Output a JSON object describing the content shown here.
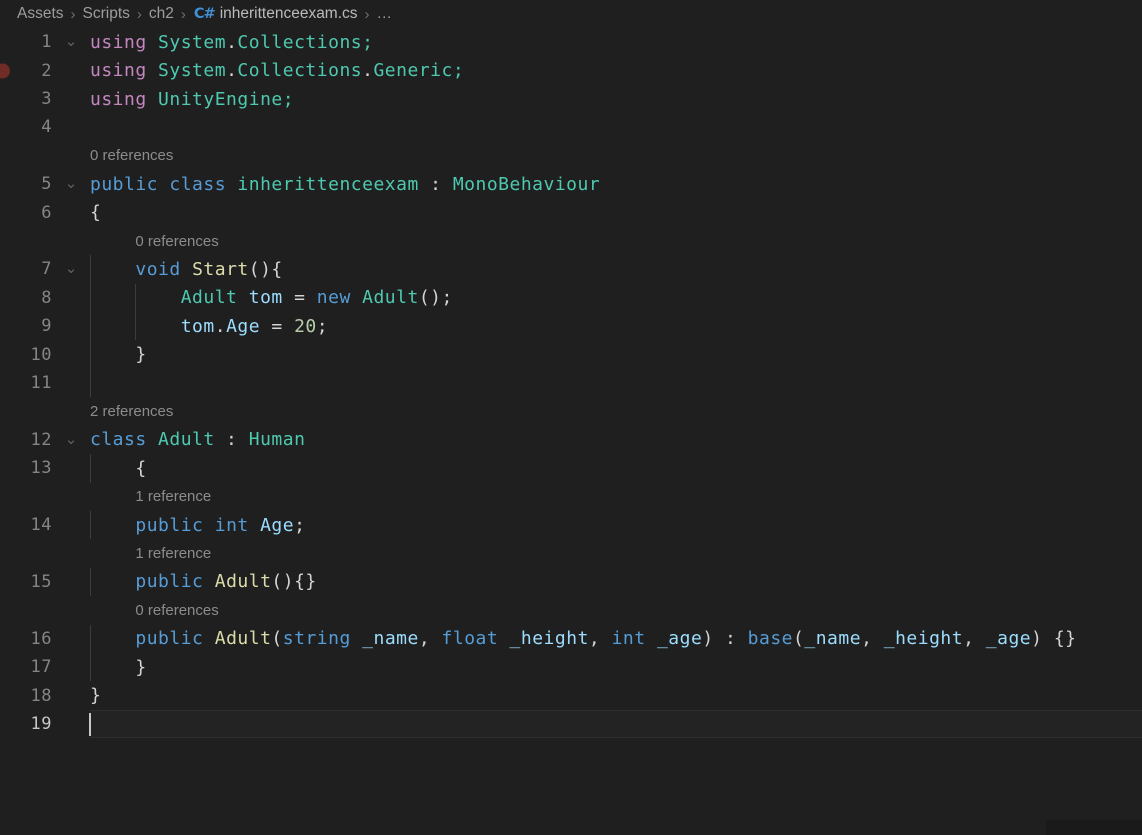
{
  "breadcrumb": {
    "separator": "›",
    "items": [
      {
        "label": "Assets"
      },
      {
        "label": "Scripts"
      },
      {
        "label": "ch2"
      },
      {
        "label": "inherittenceexam.cs",
        "icon": "csharp-file-icon",
        "icon_label": "C#",
        "is_file": true
      },
      {
        "label": "…"
      }
    ]
  },
  "editor": {
    "colors": {
      "bg": "#1f1f1f",
      "breadcrumbText": "#9d9d9d",
      "breadcrumbFile": "#bbbbbb",
      "separator": "#6f6f6f",
      "csharpIcon": "#3f8fd2",
      "lineNumber": "#858585",
      "lineNumberActive": "#c6c6c6",
      "foldIcon": "#5f6264",
      "breakpoint": "#702c26",
      "guide": "#3d3d3d",
      "currentLineBg": "#232323",
      "currentLineBorder": "#2e2e2e",
      "cursor": "#c8c8c8",
      "codelens": "#8c8c8c",
      "kw": "#569cd6",
      "ctl": "#c586c0",
      "type": "#4ec9b0",
      "fn": "#dcdcaa",
      "var": "#9cdcfe",
      "numlit": "#b5cea8",
      "plain": "#d4d4d4"
    },
    "rows": [
      {
        "type": "code",
        "num": "1",
        "fold": true,
        "tokens": [
          [
            "ctl",
            "using"
          ],
          [
            "plain",
            " "
          ],
          [
            "type",
            "System"
          ],
          [
            "plain",
            "."
          ],
          [
            "type",
            "Collections"
          ],
          [
            "type",
            ";"
          ]
        ]
      },
      {
        "type": "code",
        "num": "2",
        "bp": true,
        "tokens": [
          [
            "ctl",
            "using"
          ],
          [
            "plain",
            " "
          ],
          [
            "type",
            "System"
          ],
          [
            "plain",
            "."
          ],
          [
            "type",
            "Collections"
          ],
          [
            "plain",
            "."
          ],
          [
            "type",
            "Generic"
          ],
          [
            "type",
            ";"
          ]
        ]
      },
      {
        "type": "code",
        "num": "3",
        "tokens": [
          [
            "ctl",
            "using"
          ],
          [
            "plain",
            " "
          ],
          [
            "type",
            "UnityEngine"
          ],
          [
            "type",
            ";"
          ]
        ]
      },
      {
        "type": "code",
        "num": "4",
        "tokens": []
      },
      {
        "type": "lens",
        "text": "0 references",
        "indent": 0
      },
      {
        "type": "code",
        "num": "5",
        "fold": true,
        "tokens": [
          [
            "kw",
            "public"
          ],
          [
            "plain",
            " "
          ],
          [
            "kw",
            "class"
          ],
          [
            "plain",
            " "
          ],
          [
            "type",
            "inherittenceexam"
          ],
          [
            "plain",
            " : "
          ],
          [
            "type",
            "MonoBehaviour"
          ]
        ]
      },
      {
        "type": "code",
        "num": "6",
        "tokens": [
          [
            "plain",
            "{"
          ]
        ]
      },
      {
        "type": "lens",
        "text": "0 references",
        "indent": 4
      },
      {
        "type": "code",
        "num": "7",
        "fold": true,
        "guides": [
          0
        ],
        "tokens": [
          [
            "plain",
            "    "
          ],
          [
            "kw",
            "void"
          ],
          [
            "plain",
            " "
          ],
          [
            "fn",
            "Start"
          ],
          [
            "plain",
            "(){"
          ]
        ]
      },
      {
        "type": "code",
        "num": "8",
        "guides": [
          0,
          4
        ],
        "tokens": [
          [
            "plain",
            "        "
          ],
          [
            "type",
            "Adult"
          ],
          [
            "plain",
            " "
          ],
          [
            "var",
            "tom"
          ],
          [
            "plain",
            " = "
          ],
          [
            "kw",
            "new"
          ],
          [
            "plain",
            " "
          ],
          [
            "type",
            "Adult"
          ],
          [
            "plain",
            "();"
          ]
        ]
      },
      {
        "type": "code",
        "num": "9",
        "guides": [
          0,
          4
        ],
        "tokens": [
          [
            "plain",
            "        "
          ],
          [
            "var",
            "tom"
          ],
          [
            "plain",
            "."
          ],
          [
            "var",
            "Age"
          ],
          [
            "plain",
            " = "
          ],
          [
            "num",
            "20"
          ],
          [
            "plain",
            ";"
          ]
        ]
      },
      {
        "type": "code",
        "num": "10",
        "guides": [
          0
        ],
        "tokens": [
          [
            "plain",
            "    }"
          ]
        ]
      },
      {
        "type": "code",
        "num": "11",
        "guides": [
          0
        ],
        "tokens": []
      },
      {
        "type": "lens",
        "text": "2 references",
        "indent": 0
      },
      {
        "type": "code",
        "num": "12",
        "fold": true,
        "tokens": [
          [
            "kw",
            "class"
          ],
          [
            "plain",
            " "
          ],
          [
            "type",
            "Adult"
          ],
          [
            "plain",
            " : "
          ],
          [
            "type",
            "Human"
          ]
        ]
      },
      {
        "type": "code",
        "num": "13",
        "guides": [
          0
        ],
        "tokens": [
          [
            "plain",
            "    {"
          ]
        ]
      },
      {
        "type": "lens",
        "text": "1 reference",
        "indent": 4
      },
      {
        "type": "code",
        "num": "14",
        "guides": [
          0
        ],
        "tokens": [
          [
            "plain",
            "    "
          ],
          [
            "kw",
            "public"
          ],
          [
            "plain",
            " "
          ],
          [
            "kw",
            "int"
          ],
          [
            "plain",
            " "
          ],
          [
            "var",
            "Age"
          ],
          [
            "plain",
            ";"
          ]
        ]
      },
      {
        "type": "lens",
        "text": "1 reference",
        "indent": 4
      },
      {
        "type": "code",
        "num": "15",
        "guides": [
          0
        ],
        "tokens": [
          [
            "plain",
            "    "
          ],
          [
            "kw",
            "public"
          ],
          [
            "plain",
            " "
          ],
          [
            "fn",
            "Adult"
          ],
          [
            "plain",
            "(){}"
          ]
        ]
      },
      {
        "type": "lens",
        "text": "0 references",
        "indent": 4
      },
      {
        "type": "code",
        "num": "16",
        "guides": [
          0
        ],
        "tokens": [
          [
            "plain",
            "    "
          ],
          [
            "kw",
            "public"
          ],
          [
            "plain",
            " "
          ],
          [
            "fn",
            "Adult"
          ],
          [
            "plain",
            "("
          ],
          [
            "kw",
            "string"
          ],
          [
            "plain",
            " "
          ],
          [
            "var",
            "_name"
          ],
          [
            "plain",
            ", "
          ],
          [
            "kw",
            "float"
          ],
          [
            "plain",
            " "
          ],
          [
            "var",
            "_height"
          ],
          [
            "plain",
            ", "
          ],
          [
            "kw",
            "int"
          ],
          [
            "plain",
            " "
          ],
          [
            "var",
            "_age"
          ],
          [
            "plain",
            ") : "
          ],
          [
            "kw",
            "base"
          ],
          [
            "plain",
            "("
          ],
          [
            "var",
            "_name"
          ],
          [
            "plain",
            ", "
          ],
          [
            "var",
            "_height"
          ],
          [
            "plain",
            ", "
          ],
          [
            "var",
            "_age"
          ],
          [
            "plain",
            ") {}"
          ]
        ]
      },
      {
        "type": "code",
        "num": "17",
        "guides": [
          0
        ],
        "tokens": [
          [
            "plain",
            "    }"
          ]
        ]
      },
      {
        "type": "code",
        "num": "18",
        "tokens": [
          [
            "plain",
            "}"
          ]
        ]
      },
      {
        "type": "code",
        "num": "19",
        "active": true,
        "cursor": true,
        "tokens": []
      }
    ]
  }
}
